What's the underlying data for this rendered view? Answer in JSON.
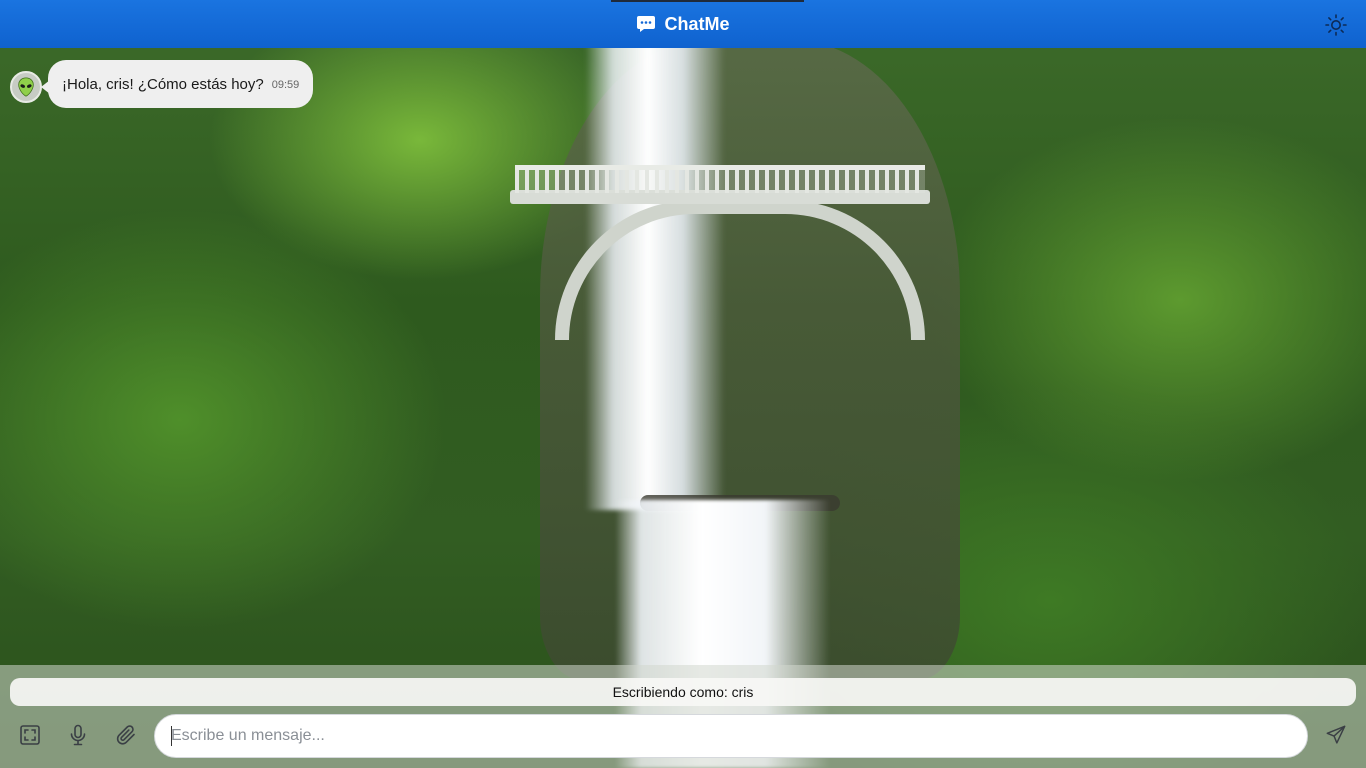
{
  "app": {
    "title": "ChatMe",
    "brand_icon": "chat-bubble-icon",
    "accent_color": "#1a6fdc",
    "theme_icon": "sun-icon"
  },
  "messages": [
    {
      "sender_avatar_icon": "alien-icon",
      "text": "¡Hola, cris! ¿Cómo estás hoy?",
      "time": "09:59"
    }
  ],
  "composer": {
    "typing_status": "Escribiendo como: cris",
    "placeholder": "Escribe un mensaje...",
    "value": "",
    "tools": [
      {
        "icon": "fullscreen-icon"
      },
      {
        "icon": "microphone-icon"
      },
      {
        "icon": "paperclip-icon"
      }
    ],
    "send_icon": "send-icon"
  }
}
